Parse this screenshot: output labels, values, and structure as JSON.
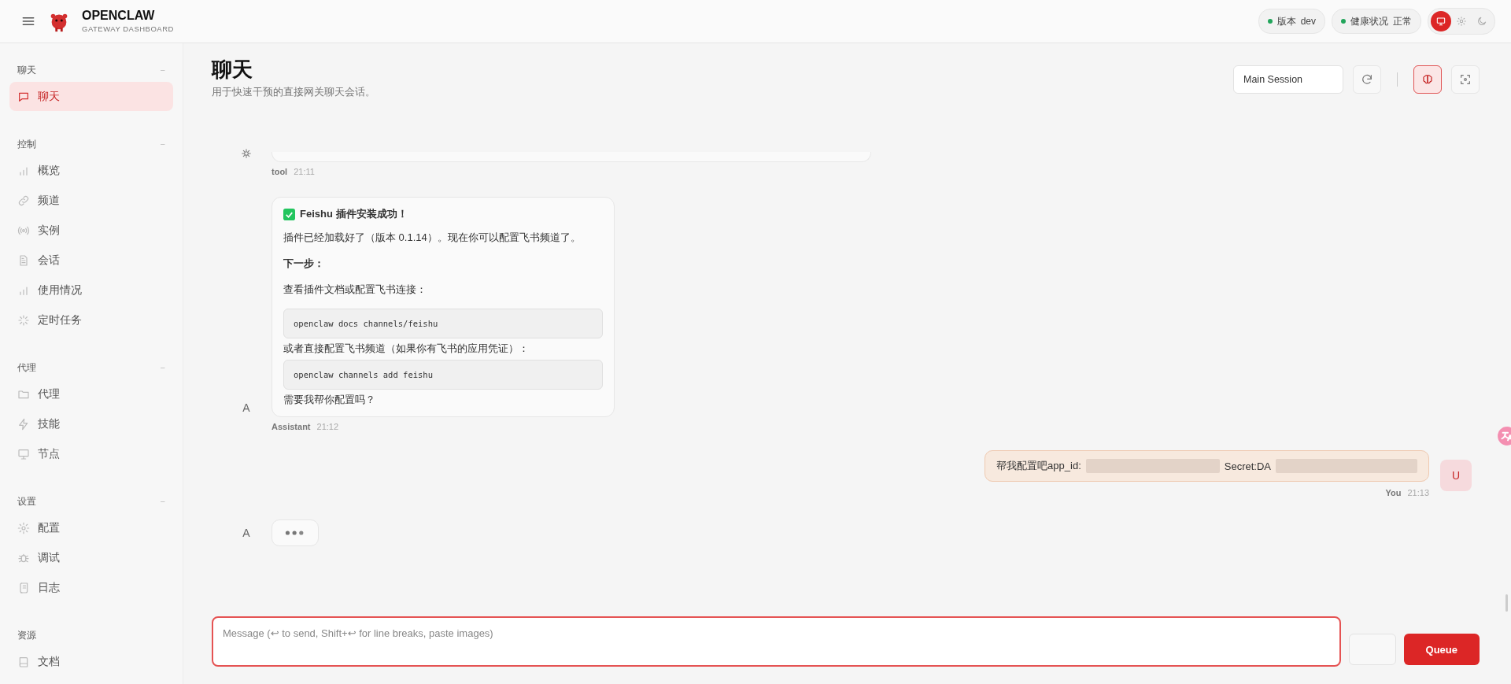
{
  "header": {
    "brand_title": "OPENCLAW",
    "brand_subtitle": "GATEWAY DASHBOARD",
    "pills": [
      {
        "label": "版本",
        "value": "dev",
        "color": "#22a55b"
      },
      {
        "label": "健康状况",
        "value": "正常",
        "color": "#22a55b"
      }
    ],
    "theme_options": [
      {
        "kind": "system",
        "selected": true
      },
      {
        "kind": "light",
        "selected": false
      },
      {
        "kind": "dark",
        "selected": false
      }
    ]
  },
  "sidebar": {
    "sections": [
      {
        "title": "聊天",
        "toggle": "−",
        "items": [
          {
            "label": "聊天",
            "kind": "chat",
            "selected": true
          }
        ]
      },
      {
        "title": "控制",
        "toggle": "−",
        "items": [
          {
            "label": "概览",
            "kind": "bars",
            "selected": false
          },
          {
            "label": "频道",
            "kind": "link",
            "selected": false
          },
          {
            "label": "实例",
            "kind": "radio",
            "selected": false
          },
          {
            "label": "会话",
            "kind": "file",
            "selected": false
          },
          {
            "label": "使用情况",
            "kind": "bars",
            "selected": false
          },
          {
            "label": "定时任务",
            "kind": "loader",
            "selected": false
          }
        ]
      },
      {
        "title": "代理",
        "toggle": "−",
        "items": [
          {
            "label": "代理",
            "kind": "folder",
            "selected": false
          },
          {
            "label": "技能",
            "kind": "bolt",
            "selected": false
          },
          {
            "label": "节点",
            "kind": "monitor",
            "selected": false
          }
        ]
      },
      {
        "title": "设置",
        "toggle": "−",
        "items": [
          {
            "label": "配置",
            "kind": "gear",
            "selected": false
          },
          {
            "label": "调试",
            "kind": "bug",
            "selected": false
          },
          {
            "label": "日志",
            "kind": "scroll",
            "selected": false
          }
        ]
      },
      {
        "title": "资源",
        "items": [
          {
            "label": "文档",
            "kind": "book",
            "selected": false
          }
        ]
      }
    ]
  },
  "page": {
    "title": "聊天",
    "subtitle": "用于快速干预的直接网关聊天会话。",
    "session": "Main Session",
    "toolbar": [
      {
        "kind": "refresh",
        "selected": false
      },
      {
        "kind": "brain",
        "selected": true
      },
      {
        "kind": "focus",
        "selected": false
      }
    ]
  },
  "messages": [
    {
      "kind": "tool",
      "sender": "tool",
      "time": "21:11"
    },
    {
      "kind": "assistant",
      "avatar": "A",
      "sender": "Assistant",
      "time": "21:12",
      "blocks": [
        {
          "kind": "heading",
          "text": "Feishu 插件安装成功！"
        },
        {
          "kind": "paragraph",
          "text": "插件已经加载好了（版本 0.1.14）。现在你可以配置飞书频道了。"
        },
        {
          "kind": "strong",
          "text": "下一步："
        },
        {
          "kind": "paragraph",
          "text": "查看插件文档或配置飞书连接："
        },
        {
          "kind": "code",
          "text": "openclaw docs channels/feishu"
        },
        {
          "kind": "tight",
          "text": "或者直接配置飞书频道（如果你有飞书的应用凭证）："
        },
        {
          "kind": "code",
          "text": "openclaw channels add feishu"
        },
        {
          "kind": "tight",
          "text": "需要我帮你配置吗？"
        }
      ]
    },
    {
      "kind": "user",
      "avatar": "U",
      "sender": "You",
      "time": "21:13",
      "parts": [
        {
          "kind": "text",
          "text": "帮我配置吧app_id:"
        },
        {
          "kind": "redacted"
        },
        {
          "kind": "text",
          "text": "Secret:DA"
        },
        {
          "kind": "redacted"
        }
      ]
    },
    {
      "kind": "typing",
      "avatar": "A"
    }
  ],
  "composer": {
    "placeholder": "Message (↩ to send, Shift+↩ for line breaks, paste images)",
    "buttons": [
      {
        "kind": "secondary"
      },
      {
        "kind": "primary",
        "label": "Queue"
      }
    ]
  }
}
